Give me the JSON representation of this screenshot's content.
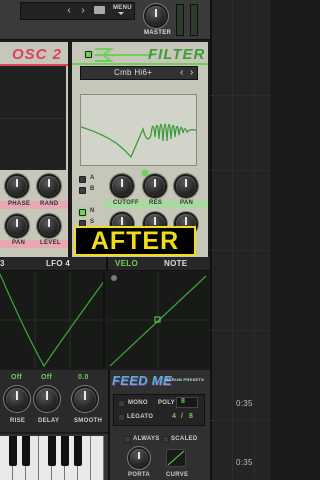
{
  "top_bar": {
    "menu_label": "MENU",
    "master_label": "MASTER"
  },
  "osc2": {
    "title": "OSC 2",
    "knobs": [
      "PHASE",
      "RAND",
      "PAN",
      "LEVEL"
    ]
  },
  "filter": {
    "title": "FILTER",
    "preset": "Cmb Hi6+",
    "prev_icon": "chevron-left-icon",
    "next_icon": "chevron-right-icon",
    "routes": [
      "A",
      "B",
      "N",
      "S"
    ],
    "knobs": [
      "CUTOFF",
      "RES",
      "PAN"
    ]
  },
  "overlay_text": "AFTER",
  "modulation": {
    "tab_left": "3",
    "tab_lfo": "LFO 4",
    "tab_velo": "VELO",
    "tab_note": "NOTE"
  },
  "lfo_controls": {
    "values": [
      "Off",
      "Off",
      "0.0"
    ],
    "knobs": [
      "RISE",
      "DELAY",
      "SMOOTH"
    ]
  },
  "voicing": {
    "logo": "FEED ME",
    "logo_sub": "SERUM PRESETS",
    "mono": "MONO",
    "poly": "POLY",
    "poly_value": "8",
    "legato": "LEGATO",
    "legato_a": "4",
    "legato_sep": "/",
    "legato_b": "8",
    "always": "ALWAYS",
    "scaled": "SCALED",
    "porta": "PORTA",
    "curve": "CURVE"
  },
  "timeline": {
    "time_1": "0:35",
    "time_2": "0:35"
  },
  "colors": {
    "accent": "#6ecf5b",
    "osc_header": "#e0405f",
    "panel": "#c9c9bc",
    "yellow": "#f2dc1a"
  }
}
